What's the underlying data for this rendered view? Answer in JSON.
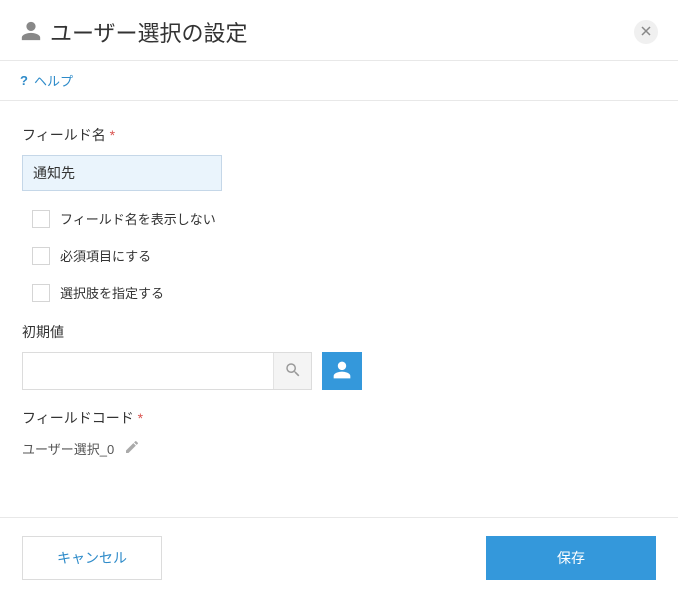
{
  "header": {
    "title": "ユーザー選択の設定"
  },
  "help": {
    "label": "ヘルプ"
  },
  "fieldName": {
    "label": "フィールド名",
    "required_mark": "*",
    "value": "通知先"
  },
  "checkboxes": {
    "hideFieldName": {
      "label": "フィールド名を表示しない"
    },
    "required": {
      "label": "必須項目にする"
    },
    "restrictOptions": {
      "label": "選択肢を指定する"
    }
  },
  "initialValue": {
    "label": "初期値",
    "value": ""
  },
  "fieldCode": {
    "label": "フィールドコード",
    "required_mark": "*",
    "value": "ユーザー選択_0"
  },
  "footer": {
    "cancel": "キャンセル",
    "save": "保存"
  }
}
